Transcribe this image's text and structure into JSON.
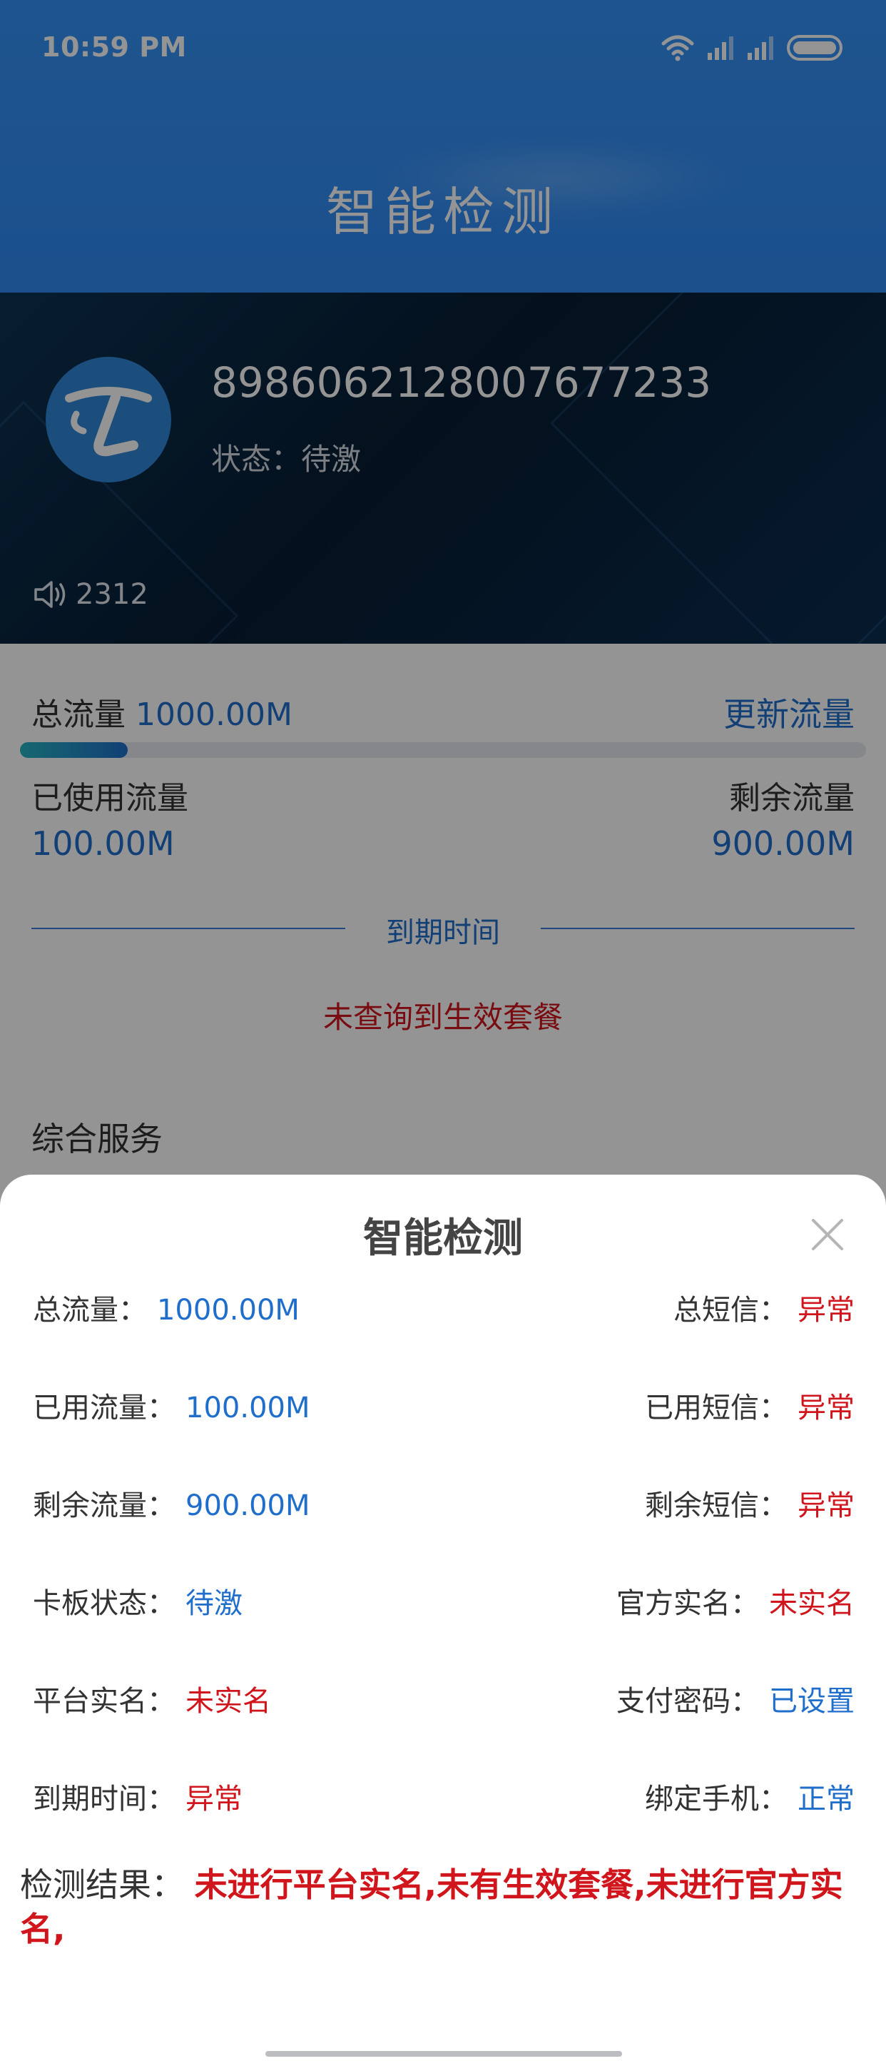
{
  "status_bar": {
    "time": "10:59 PM"
  },
  "header": {
    "title": "智能检测"
  },
  "card": {
    "iccid": "89860621280076772​33",
    "status_label": "状态：",
    "status_value": "待激",
    "ticker_text": "2312"
  },
  "usage": {
    "total_label": "总流量",
    "total_value": "1000.00M",
    "refresh_label": "更新流量",
    "used_fraction": 0.1,
    "used_label": "已使用流量",
    "used_value": "100.00M",
    "remaining_label": "剩余流量",
    "remaining_value": "900.00M",
    "expiry_label": "到期时间",
    "no_plan_text": "未查询到生效套餐",
    "services_title": "综合服务"
  },
  "sheet": {
    "title": "智能检测",
    "rows": [
      {
        "left_label": "总流量：",
        "left_value": "1000.00M",
        "right_label": "总短信：",
        "right_value": "异常"
      },
      {
        "left_label": "已用流量：",
        "left_value": "100.00M",
        "right_label": "已用短信：",
        "right_value": "异常"
      },
      {
        "left_label": "剩余流量：",
        "left_value": "900.00M",
        "right_label": "剩余短信：",
        "right_value": "异常"
      },
      {
        "left_label": "卡板状态：",
        "left_value": "待激",
        "right_label": "官方实名：",
        "right_value": "未实名"
      },
      {
        "left_label": "平台实名：",
        "left_value": "未实名",
        "right_label": "支付密码：",
        "right_value": "已设置"
      },
      {
        "left_label": "到期时间：",
        "left_value": "异常",
        "right_label": "绑定手机：",
        "right_value": "正常"
      }
    ],
    "result_label": "检测结果：",
    "result_value": "未进行平台实名,未有生效套餐,未进行官方实名,"
  },
  "colors": {
    "accent_blue": "#1f6ecb",
    "alert_red": "#d0161c",
    "header_blue": "#3592f6"
  },
  "icons": [
    "wifi-icon",
    "signal-icon",
    "battery-icon",
    "carrier-logo-icon",
    "speaker-icon",
    "close-icon"
  ]
}
